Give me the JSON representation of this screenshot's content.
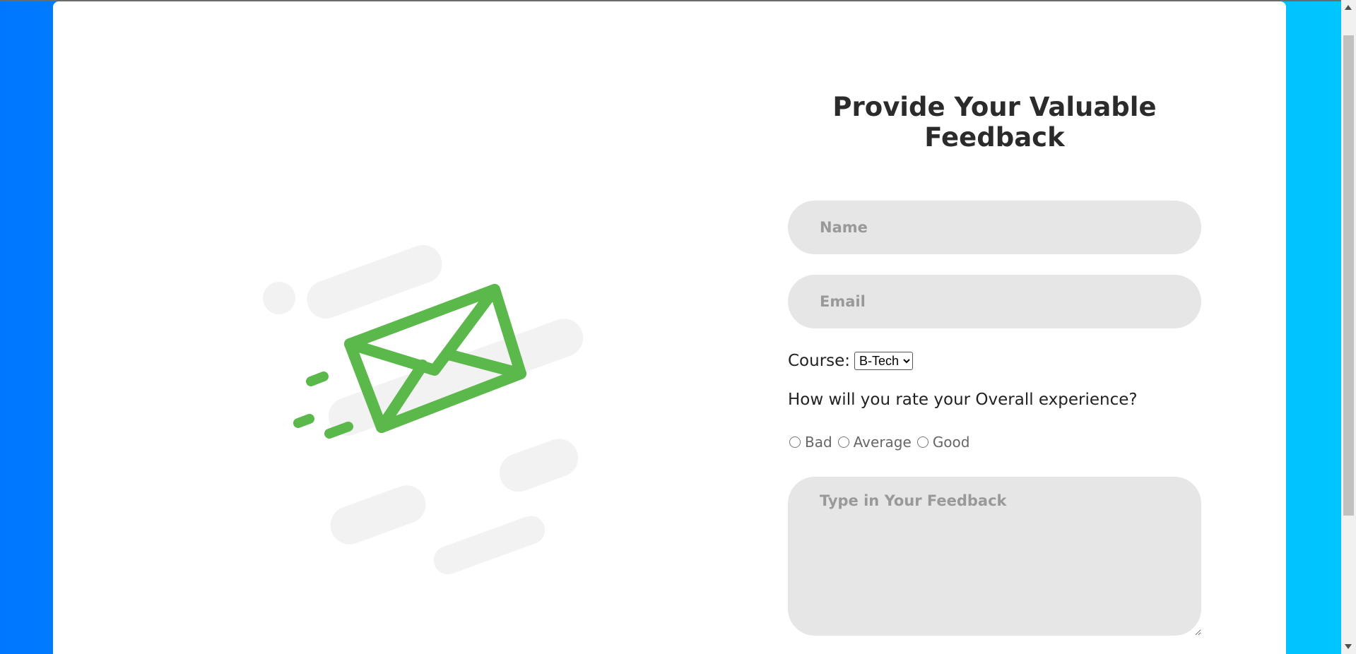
{
  "form": {
    "title": "Provide Your Valuable Feedback",
    "name_placeholder": "Name",
    "email_placeholder": "Email",
    "course_label": "Course:",
    "course_selected": "B-Tech",
    "question": "How will you rate your Overall experience?",
    "ratings": [
      {
        "label": "Bad"
      },
      {
        "label": "Average"
      },
      {
        "label": "Good"
      }
    ],
    "feedback_placeholder": "Type in Your Feedback"
  },
  "colors": {
    "bg_gradient_start": "#0077ff",
    "bg_gradient_end": "#00c6ff",
    "card": "#ffffff",
    "input_bg": "#e6e6e6",
    "envelope": "#5bb84a",
    "decor": "#f2f2f2"
  },
  "illustration": {
    "icon": "paper-plane-envelope-icon"
  }
}
